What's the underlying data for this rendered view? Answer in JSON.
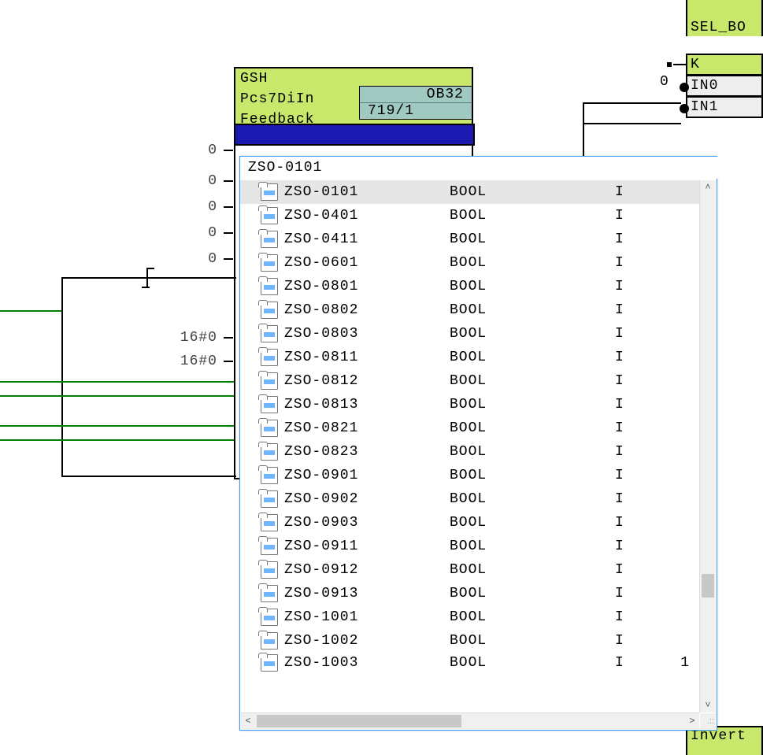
{
  "block": {
    "title": "GSH",
    "type": "Pcs7DiIn",
    "subtitle": "Feedback",
    "ob": "OB32",
    "exec": "719/1",
    "selected_row_l": "",
    "selected_row_r": ""
  },
  "block_pins": {
    "vals": [
      "0",
      "0",
      "0",
      "0",
      "0",
      "",
      "",
      "16#0",
      "16#0",
      "",
      "",
      "",
      "",
      ""
    ]
  },
  "right_top": {
    "line1_partial": "",
    "line2": "SEL_BO",
    "k_label": "K",
    "k_val": "0",
    "in0": "IN0",
    "in1": "IN1"
  },
  "right_bot": {
    "line1": "Invert",
    "line2_partial": ""
  },
  "popup": {
    "search": "ZSO-0101",
    "items": [
      {
        "name": "ZSO-0101",
        "type": "BOOL",
        "area": "I",
        "addr": "",
        "sel": true
      },
      {
        "name": "ZSO-0401",
        "type": "BOOL",
        "area": "I",
        "addr": ""
      },
      {
        "name": "ZSO-0411",
        "type": "BOOL",
        "area": "I",
        "addr": ""
      },
      {
        "name": "ZSO-0601",
        "type": "BOOL",
        "area": "I",
        "addr": ""
      },
      {
        "name": "ZSO-0801",
        "type": "BOOL",
        "area": "I",
        "addr": ""
      },
      {
        "name": "ZSO-0802",
        "type": "BOOL",
        "area": "I",
        "addr": ""
      },
      {
        "name": "ZSO-0803",
        "type": "BOOL",
        "area": "I",
        "addr": ""
      },
      {
        "name": "ZSO-0811",
        "type": "BOOL",
        "area": "I",
        "addr": ""
      },
      {
        "name": "ZSO-0812",
        "type": "BOOL",
        "area": "I",
        "addr": ""
      },
      {
        "name": "ZSO-0813",
        "type": "BOOL",
        "area": "I",
        "addr": ""
      },
      {
        "name": "ZSO-0821",
        "type": "BOOL",
        "area": "I",
        "addr": ""
      },
      {
        "name": "ZSO-0823",
        "type": "BOOL",
        "area": "I",
        "addr": ""
      },
      {
        "name": "ZSO-0901",
        "type": "BOOL",
        "area": "I",
        "addr": ""
      },
      {
        "name": "ZSO-0902",
        "type": "BOOL",
        "area": "I",
        "addr": ""
      },
      {
        "name": "ZSO-0903",
        "type": "BOOL",
        "area": "I",
        "addr": ""
      },
      {
        "name": "ZSO-0911",
        "type": "BOOL",
        "area": "I",
        "addr": ""
      },
      {
        "name": "ZSO-0912",
        "type": "BOOL",
        "area": "I",
        "addr": ""
      },
      {
        "name": "ZSO-0913",
        "type": "BOOL",
        "area": "I",
        "addr": ""
      },
      {
        "name": "ZSO-1001",
        "type": "BOOL",
        "area": "I",
        "addr": ""
      },
      {
        "name": "ZSO-1002",
        "type": "BOOL",
        "area": "I",
        "addr": ""
      },
      {
        "name": "ZSO-1003",
        "type": "BOOL",
        "area": "I",
        "addr": "1"
      }
    ]
  }
}
